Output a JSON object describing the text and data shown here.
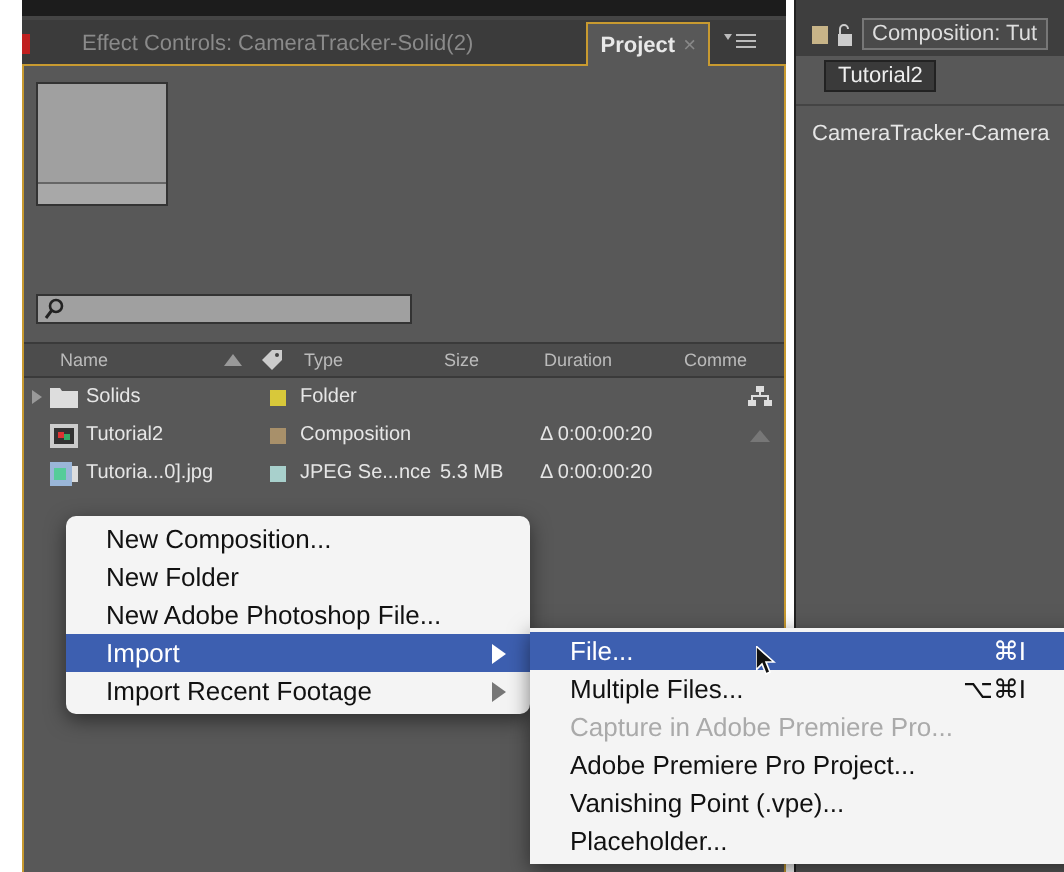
{
  "left_panel": {
    "tabs": [
      {
        "label": "Effect Controls: CameraTracker-Solid(2)",
        "selected": false
      },
      {
        "label": "Project",
        "selected": true,
        "close": "×"
      }
    ],
    "table": {
      "columns": [
        "Name",
        "Type",
        "Size",
        "Duration",
        "Comme"
      ],
      "rows": [
        {
          "kind": "folder",
          "name": "Solids",
          "color": "#d8c83a",
          "type": "Folder"
        },
        {
          "kind": "composition",
          "name": "Tutorial2",
          "color": "#a8906a",
          "type": "Composition",
          "duration": "Δ 0:00:00:20"
        },
        {
          "kind": "image",
          "name": "Tutoria...0].jpg",
          "color": "#a8d0cc",
          "type": "JPEG Se...nce",
          "size": "5.3 MB",
          "duration": "Δ 0:00:00:20"
        }
      ]
    }
  },
  "right_panel": {
    "tab": "Composition: Tut",
    "view_button": "Tutorial2",
    "layer": "CameraTracker-Camera"
  },
  "context_menu": {
    "items": [
      {
        "label": "New Composition...",
        "selected": false,
        "submenu": false
      },
      {
        "label": "New Folder",
        "selected": false,
        "submenu": false
      },
      {
        "label": "New Adobe Photoshop File...",
        "selected": false,
        "submenu": false
      },
      {
        "label": "Import",
        "selected": true,
        "submenu": true
      },
      {
        "label": "Import Recent Footage",
        "selected": false,
        "submenu": true
      }
    ]
  },
  "submenu": {
    "items": [
      {
        "label": "File...",
        "shortcut": "⌘I",
        "selected": true,
        "disabled": false
      },
      {
        "label": "Multiple Files...",
        "shortcut": "⌥⌘I",
        "selected": false,
        "disabled": false
      },
      {
        "label": "Capture in Adobe Premiere Pro...",
        "selected": false,
        "disabled": true
      },
      {
        "label": "Adobe Premiere Pro Project...",
        "selected": false,
        "disabled": false
      },
      {
        "label": "Vanishing Point (.vpe)...",
        "selected": false,
        "disabled": false
      },
      {
        "label": "Placeholder...",
        "selected": false,
        "disabled": false
      }
    ]
  }
}
